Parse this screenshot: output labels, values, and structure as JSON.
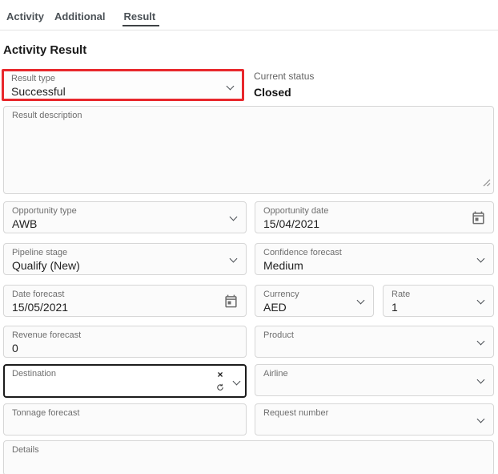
{
  "tabs": {
    "items": [
      {
        "label": "Activity",
        "active": false
      },
      {
        "label": "Additional",
        "active": false
      },
      {
        "label": "Result",
        "active": true
      }
    ]
  },
  "heading": "Activity Result",
  "colors": {
    "highlight_red": "#e8282c",
    "focus_border": "#1c1c1c",
    "field_border": "#d6d6d6",
    "field_bg": "#fbfbfb",
    "label_gray": "#6e6e6e",
    "value_dark": "#1f1f1f",
    "tab_text": "#4c5257",
    "active_underline": "#3f4346",
    "divider": "#e3e3e3"
  },
  "icons": {
    "clear_glyph": "×",
    "dropdown": "chevron-down",
    "date": "calendar-outline",
    "refresh": "circular-arrow",
    "resize": "diagonal-grip"
  },
  "form": {
    "result_type": {
      "label": "Result type",
      "value": "Successful"
    },
    "current_status": {
      "label": "Current status",
      "value": "Closed"
    },
    "result_description": {
      "label": "Result description",
      "value": ""
    },
    "opportunity_type": {
      "label": "Opportunity type",
      "value": "AWB"
    },
    "opportunity_date": {
      "label": "Opportunity date",
      "value": "15/04/2021"
    },
    "pipeline_stage": {
      "label": "Pipeline stage",
      "value": "Qualify (New)"
    },
    "confidence_forecast": {
      "label": "Confidence forecast",
      "value": "Medium"
    },
    "date_forecast": {
      "label": "Date forecast",
      "value": "15/05/2021"
    },
    "currency": {
      "label": "Currency",
      "value": "AED"
    },
    "rate": {
      "label": "Rate",
      "value": "1"
    },
    "revenue_forecast": {
      "label": "Revenue forecast",
      "value": "0"
    },
    "product": {
      "label": "Product",
      "value": ""
    },
    "destination": {
      "label": "Destination",
      "value": ""
    },
    "airline": {
      "label": "Airline",
      "value": ""
    },
    "tonnage_forecast": {
      "label": "Tonnage forecast",
      "value": ""
    },
    "request_number": {
      "label": "Request number",
      "value": ""
    },
    "details": {
      "label": "Details",
      "value": ""
    }
  }
}
